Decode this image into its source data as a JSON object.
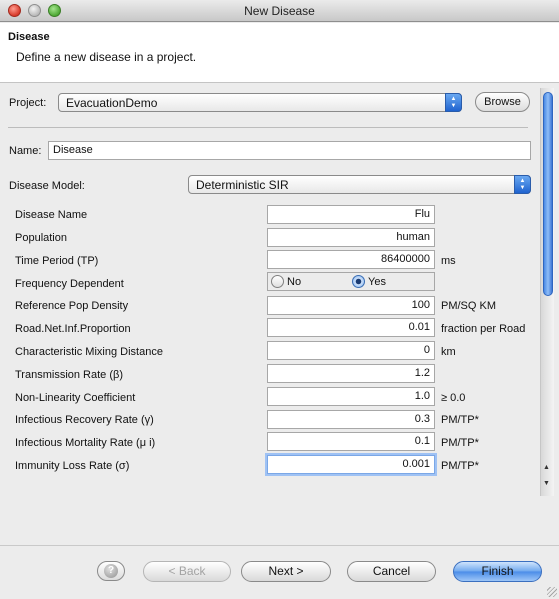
{
  "window": {
    "title": "New Disease"
  },
  "header": {
    "title": "Disease",
    "description": "Define a new disease in a project."
  },
  "project": {
    "label": "Project:",
    "value": "EvacuationDemo",
    "browse_label": "Browse"
  },
  "name": {
    "label": "Name:",
    "value": "Disease"
  },
  "model": {
    "label": "Disease Model:",
    "value": "Deterministic SIR"
  },
  "params": [
    {
      "label": "Disease Name",
      "value": "Flu",
      "unit": ""
    },
    {
      "label": "Population",
      "value": "human",
      "unit": ""
    },
    {
      "label": "Time Period (TP)",
      "value": "86400000",
      "unit": "ms"
    },
    {
      "label": "Frequency Dependent",
      "value": "",
      "unit": ""
    },
    {
      "label": "Reference Pop Density",
      "value": "100",
      "unit": "PM/SQ KM"
    },
    {
      "label": "Road.Net.Inf.Proportion",
      "value": "0.01",
      "unit": "fraction per Road"
    },
    {
      "label": "Characteristic Mixing Distance",
      "value": "0",
      "unit": "km"
    },
    {
      "label": "Transmission Rate (β)",
      "value": "1.2",
      "unit": ""
    },
    {
      "label": "Non-Linearity Coefficient",
      "value": "1.0",
      "unit": "≥ 0.0"
    },
    {
      "label": "Infectious Recovery Rate (γ)",
      "value": "0.3",
      "unit": "PM/TP*"
    },
    {
      "label": "Infectious Mortality Rate (μ i)",
      "value": "0.1",
      "unit": "PM/TP*"
    },
    {
      "label": "Immunity Loss Rate (σ)",
      "value": "0.001",
      "unit": "PM/TP*"
    }
  ],
  "frequency_dependent": {
    "options": [
      "No",
      "Yes"
    ],
    "selected": "Yes"
  },
  "footer": {
    "back": "< Back",
    "next": "Next >",
    "cancel": "Cancel",
    "finish": "Finish",
    "help_glyph": "?"
  },
  "colors": {
    "accent": "#4a8ce8",
    "focus": "#9fc2f4"
  },
  "icons": [
    "close-icon",
    "minimize-icon",
    "zoom-icon",
    "dropdown-arrow-icon",
    "help-icon",
    "resize-grip-icon"
  ]
}
